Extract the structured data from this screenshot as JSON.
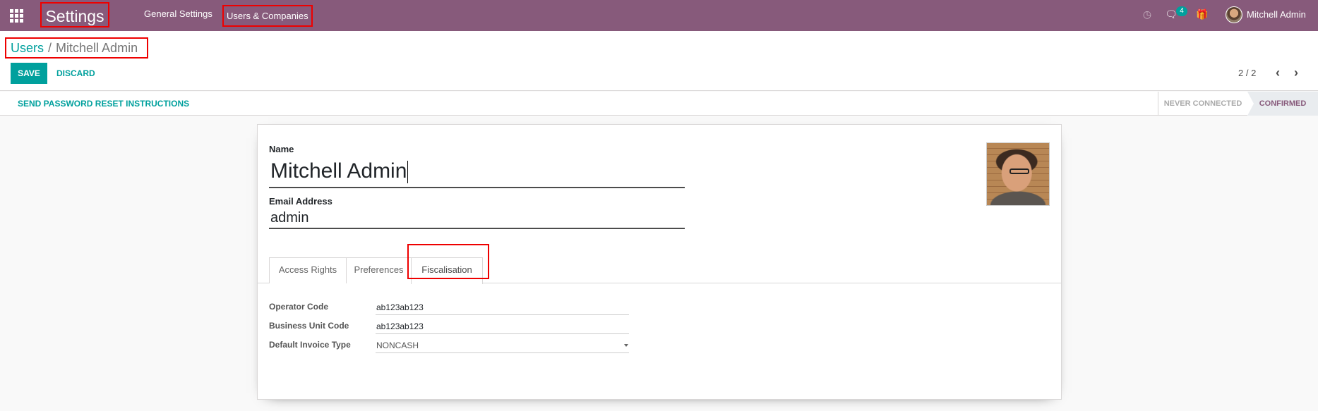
{
  "navbar": {
    "brand": "Settings",
    "menu": [
      "General Settings",
      "Users & Companies"
    ],
    "chat_count": "4",
    "user_name": "Mitchell Admin",
    "color": "#875a7b"
  },
  "breadcrumb": {
    "parent": "Users",
    "separator": "/",
    "current": "Mitchell Admin"
  },
  "buttons": {
    "save": "SAVE",
    "discard": "DISCARD"
  },
  "pager": {
    "value": "2 / 2"
  },
  "statusbar": {
    "reset_password": "SEND PASSWORD RESET INSTRUCTIONS",
    "stages": [
      "NEVER CONNECTED",
      "CONFIRMED"
    ],
    "active_stage": "CONFIRMED"
  },
  "form": {
    "name_label": "Name",
    "name_value": "Mitchell Admin",
    "email_label": "Email Address",
    "email_value": "admin"
  },
  "tabs": [
    "Access Rights",
    "Preferences",
    "Fiscalisation"
  ],
  "active_tab": "Fiscalisation",
  "fiscalisation": {
    "operator_code_label": "Operator Code",
    "operator_code_value": "ab123ab123",
    "business_unit_label": "Business Unit Code",
    "business_unit_value": "ab123ab123",
    "invoice_type_label": "Default Invoice Type",
    "invoice_type_value": "NONCASH"
  },
  "accent_color": "#00a09d"
}
